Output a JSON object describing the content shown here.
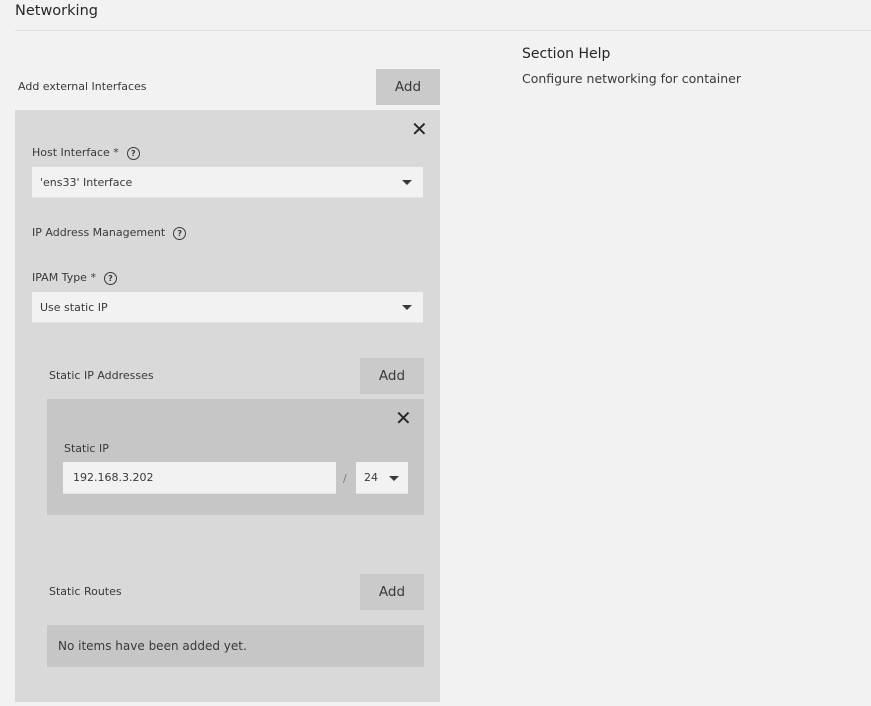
{
  "header": {
    "title": "Networking"
  },
  "interfaces": {
    "label": "Add external Interfaces",
    "add_label": "Add",
    "item": {
      "close_icon": "close-icon",
      "host_interface": {
        "label": "Host Interface *",
        "value": "'ens33' Interface"
      },
      "ipam_label": "IP Address Management",
      "ipam_type": {
        "label": "IPAM Type *",
        "value": "Use static IP"
      },
      "static_ips": {
        "label": "Static IP Addresses",
        "add_label": "Add",
        "item": {
          "label": "Static IP",
          "value": "192.168.3.202",
          "separator": "/",
          "prefix": "24"
        }
      },
      "static_routes": {
        "label": "Static Routes",
        "add_label": "Add",
        "empty": "No items have been added yet."
      }
    }
  },
  "help": {
    "title": "Section Help",
    "text": "Configure networking for container"
  }
}
